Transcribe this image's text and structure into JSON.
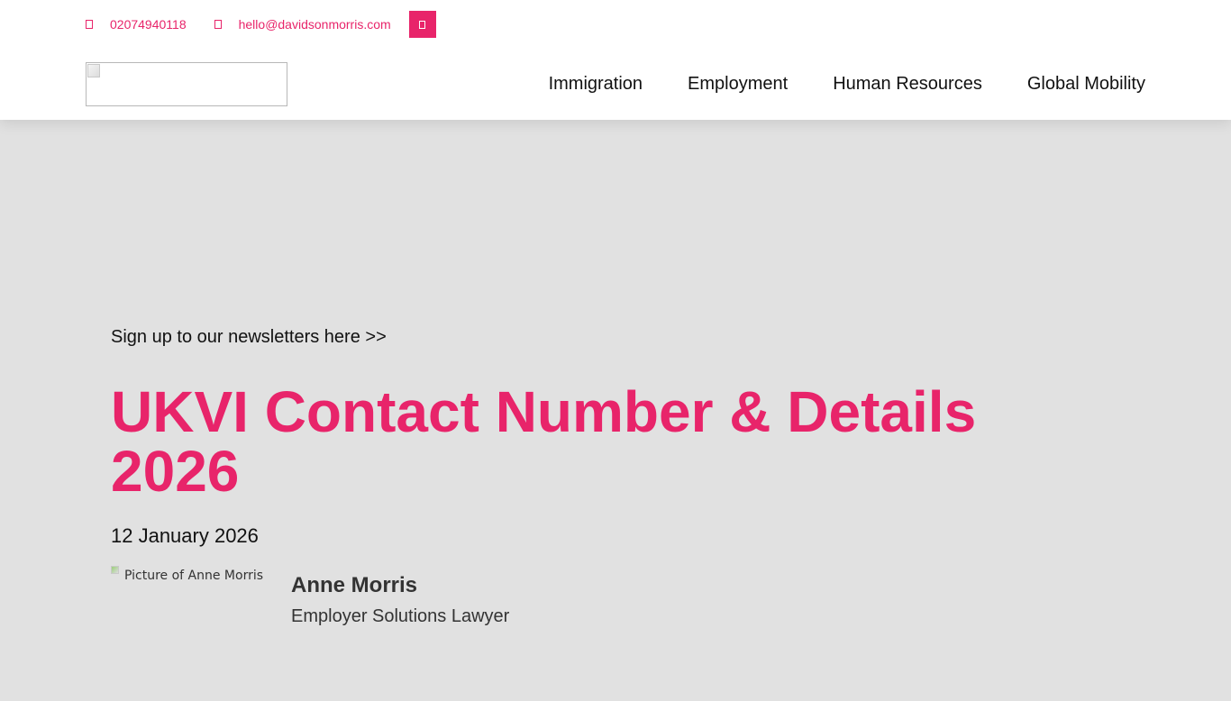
{
  "colors": {
    "accent": "#e8246a",
    "page_background": "#e1e1e1",
    "header_background": "#ffffff",
    "text": "#111111"
  },
  "topbar": {
    "phone": {
      "icon": "phone-icon",
      "text": "02074940118"
    },
    "email": {
      "icon": "envelope-icon",
      "text": "hello@davidsonmorris.com"
    },
    "social": {
      "icon": "linkedin-icon"
    }
  },
  "logo": {
    "icon": "broken-image-icon"
  },
  "nav": {
    "items": [
      {
        "label": "Immigration"
      },
      {
        "label": "Employment"
      },
      {
        "label": "Human Resources"
      },
      {
        "label": "Global Mobility"
      }
    ]
  },
  "hero": {
    "newsletter_link": "Sign up to our newsletters here >>",
    "title": "UKVI Contact Number & Details 2026",
    "date": "12 January 2026"
  },
  "author": {
    "picture_alt": "Picture of Anne Morris",
    "name": "Anne Morris",
    "role": "Employer Solutions Lawyer"
  }
}
